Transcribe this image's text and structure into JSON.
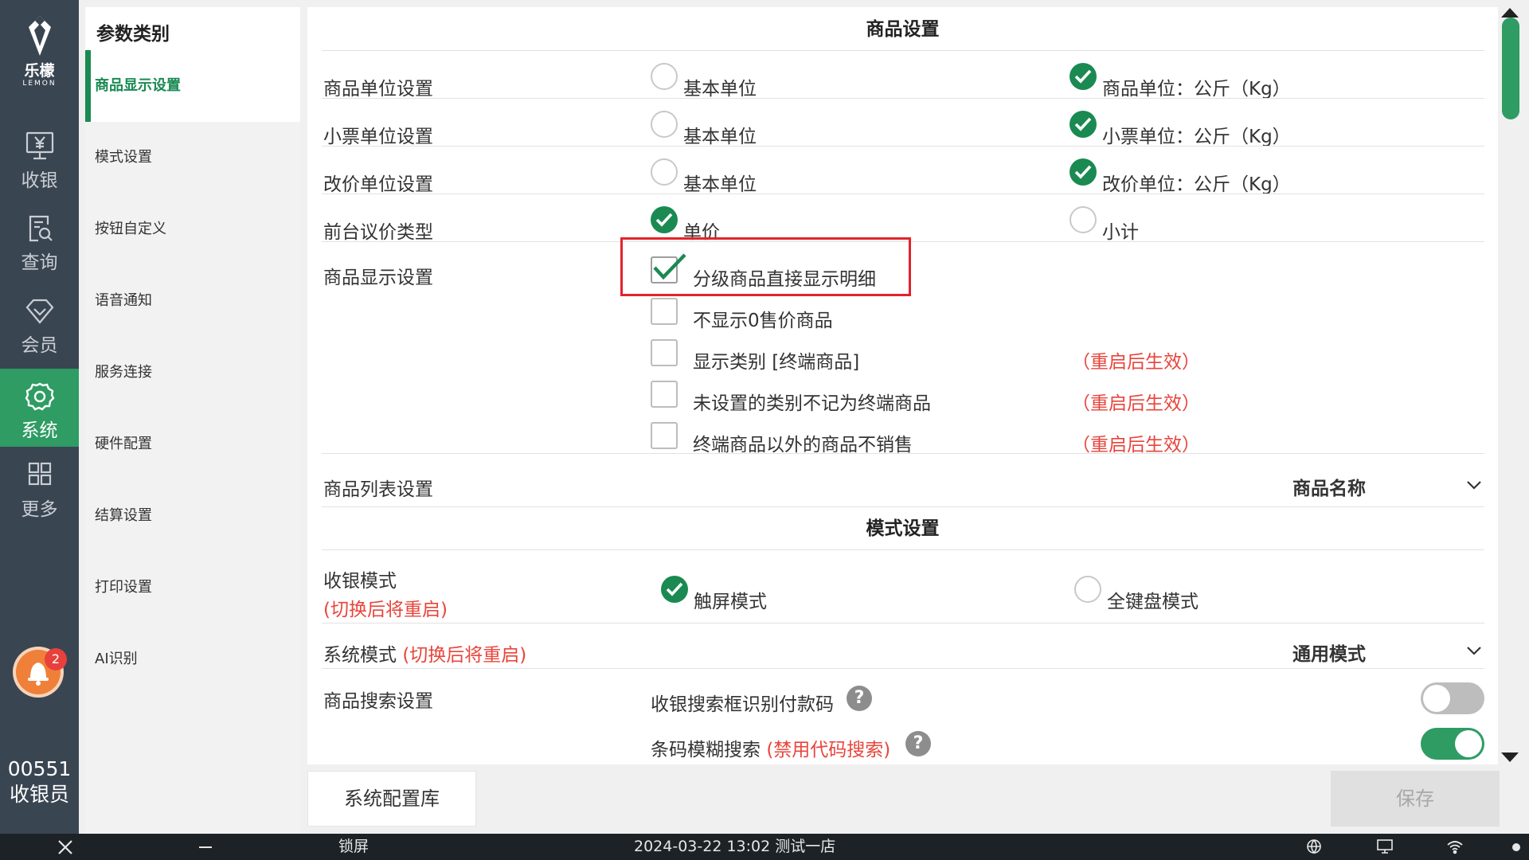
{
  "brand": {
    "name": "乐檬",
    "sub": "LEMON"
  },
  "nav": [
    {
      "label": "收银",
      "icon": "yen-monitor-icon"
    },
    {
      "label": "查询",
      "icon": "search-doc-icon"
    },
    {
      "label": "会员",
      "icon": "diamond-icon"
    },
    {
      "label": "系统",
      "icon": "gear-icon"
    },
    {
      "label": "更多",
      "icon": "grid-icon"
    }
  ],
  "active_nav": "系统",
  "notification_count": "2",
  "user": {
    "id": "00551",
    "role": "收银员"
  },
  "categories": {
    "title": "参数类别",
    "items": [
      "商品显示设置",
      "模式设置",
      "按钮自定义",
      "语音通知",
      "服务连接",
      "硬件配置",
      "结算设置",
      "打印设置",
      "AI识别"
    ],
    "active": "商品显示设置"
  },
  "goods": {
    "header": "商品设置",
    "unit_rows": [
      {
        "label": "商品单位设置",
        "opt1": "基本单位",
        "opt2": "商品单位：公斤（Kg）",
        "selected": 2
      },
      {
        "label": "小票单位设置",
        "opt1": "基本单位",
        "opt2": "小票单位：公斤（Kg）",
        "selected": 2
      },
      {
        "label": "改价单位设置",
        "opt1": "基本单位",
        "opt2": "改价单位：公斤（Kg）",
        "selected": 2
      },
      {
        "label": "前台议价类型",
        "opt1": "单价",
        "opt2": "小计",
        "selected": 1
      }
    ],
    "display": {
      "label": "商品显示设置",
      "options": [
        {
          "text": "分级商品直接显示明细",
          "checked": true,
          "note": ""
        },
        {
          "text": "不显示0售价商品",
          "checked": false,
          "note": ""
        },
        {
          "text": "显示类别 [终端商品]",
          "checked": false,
          "note": "（重启后生效）"
        },
        {
          "text": "未设置的类别不记为终端商品",
          "checked": false,
          "note": "（重启后生效）"
        },
        {
          "text": "终端商品以外的商品不销售",
          "checked": false,
          "note": "（重启后生效）"
        }
      ]
    },
    "list": {
      "label": "商品列表设置",
      "value": "商品名称"
    }
  },
  "mode": {
    "header": "模式设置",
    "cashier": {
      "label": "收银模式",
      "note": "(切换后将重启)",
      "opt1": "触屏模式",
      "opt2": "全键盘模式",
      "selected": 1
    },
    "system": {
      "label": "系统模式",
      "note": "(切换后将重启)",
      "value": "通用模式"
    },
    "search": {
      "label": "商品搜索设置",
      "toggles": [
        {
          "text": "收银搜索框识别付款码",
          "note": "",
          "on": false
        },
        {
          "text": "条码模糊搜索",
          "note": "(禁用代码搜索)",
          "on": true
        }
      ]
    }
  },
  "buttons": {
    "config": "系统配置库",
    "save": "保存"
  },
  "taskbar": {
    "lock": "锁屏",
    "datetime": "2024-03-22 13:02",
    "store": "测试一店"
  }
}
